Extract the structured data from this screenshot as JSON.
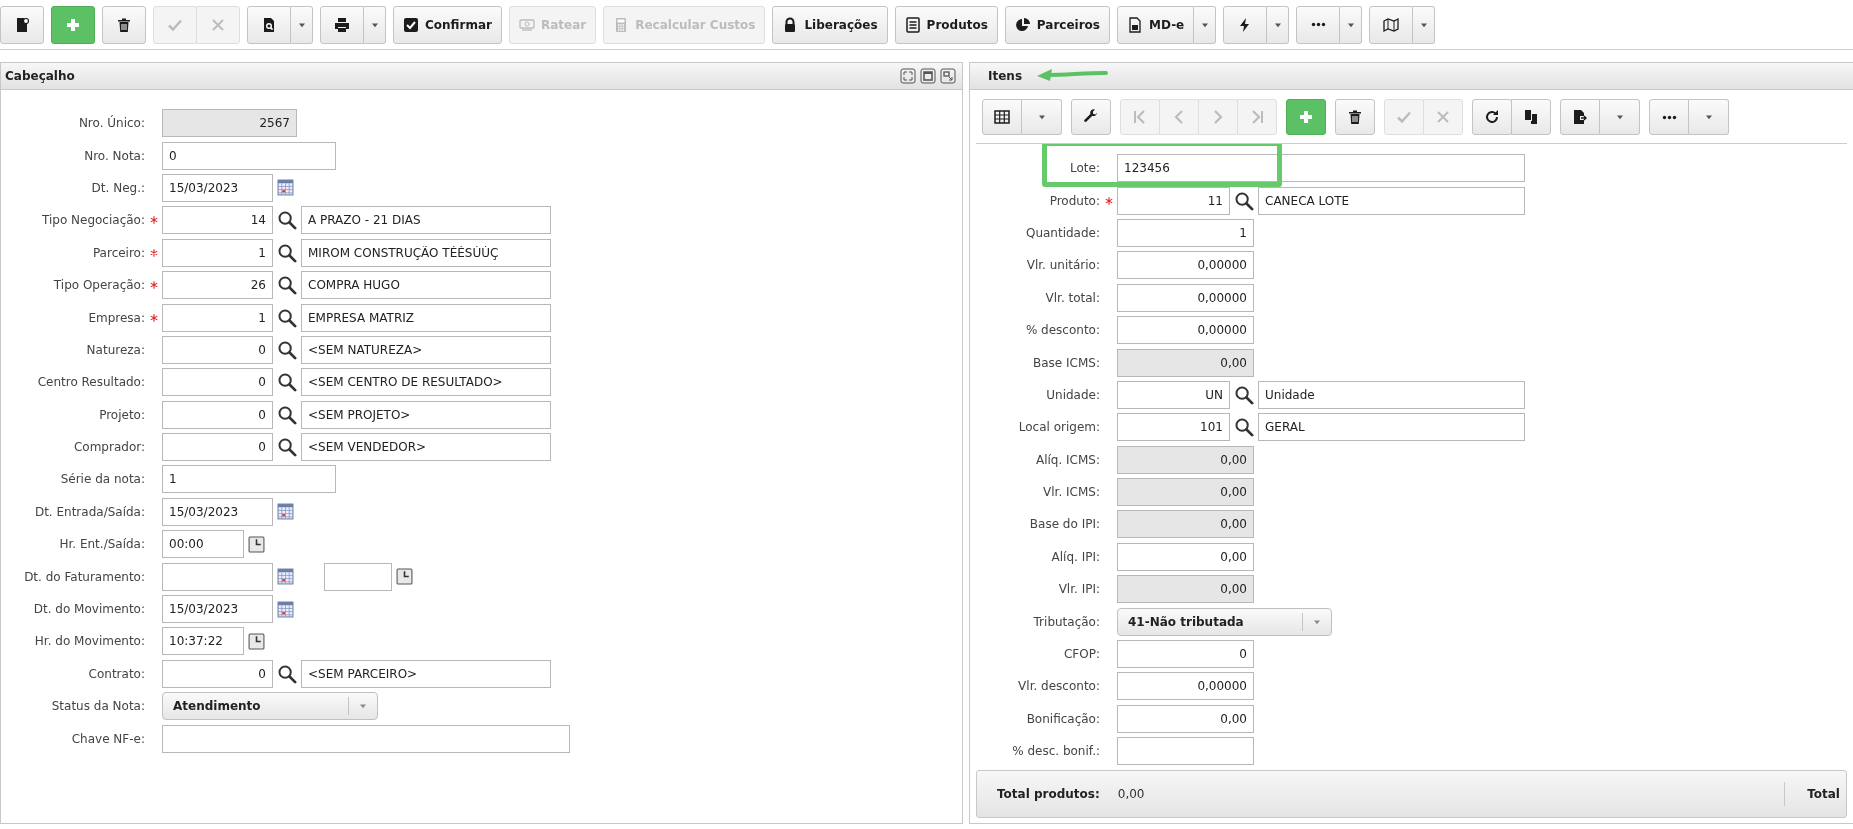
{
  "toolbar": [
    {
      "kind": "icon",
      "disabled": false,
      "dropdown": false
    },
    {
      "kind": "primary",
      "disabled": false,
      "dropdown": false
    },
    {
      "kind": "icon",
      "disabled": false,
      "dropdown": false
    },
    {
      "kind": "icon",
      "disabled": true,
      "dropdown": false
    },
    {
      "kind": "icon",
      "disabled": true,
      "dropdown": false
    },
    {
      "kind": "icon",
      "disabled": false,
      "dropdown": true
    },
    {
      "kind": "icon",
      "disabled": false,
      "dropdown": true
    },
    {
      "kind": "text",
      "label": "Confirmar",
      "disabled": false,
      "dropdown": false
    },
    {
      "kind": "text",
      "label": "Ratear",
      "disabled": true,
      "dropdown": false
    },
    {
      "kind": "text",
      "label": "Recalcular Custos",
      "disabled": true,
      "dropdown": false
    },
    {
      "kind": "text",
      "label": "Liberações",
      "disabled": false,
      "dropdown": false
    },
    {
      "kind": "text",
      "label": "Produtos",
      "disabled": false,
      "dropdown": false
    },
    {
      "kind": "text",
      "label": "Parceiros",
      "disabled": false,
      "dropdown": false
    },
    {
      "kind": "text",
      "label": "MD-e",
      "disabled": false,
      "dropdown": true
    },
    {
      "kind": "icon",
      "disabled": false,
      "dropdown": true
    },
    {
      "kind": "icon",
      "disabled": false,
      "dropdown": true
    },
    {
      "kind": "icon",
      "disabled": false,
      "dropdown": true
    }
  ],
  "header_panel": {
    "title": "Cabeçalho",
    "fields": [
      {
        "label": "Nro. Único:",
        "kind": "number",
        "value": "2567",
        "readonly": true
      },
      {
        "label": "Nro. Nota:",
        "kind": "text",
        "value": "0"
      },
      {
        "label": "Dt. Neg.:",
        "kind": "date",
        "value": "15/03/2023"
      },
      {
        "label": "Tipo Negociação:",
        "kind": "lookup",
        "required": true,
        "code": "14",
        "description": "A PRAZO - 21 DIAS"
      },
      {
        "label": "Parceiro:",
        "kind": "lookup",
        "required": true,
        "code": "1",
        "description": "MIROM CONSTRUÇÃO TÉÉSÚÚÇ"
      },
      {
        "label": "Tipo Operação:",
        "kind": "lookup",
        "required": true,
        "code": "26",
        "description": "COMPRA HUGO"
      },
      {
        "label": "Empresa:",
        "kind": "lookup",
        "required": true,
        "code": "1",
        "description": "EMPRESA MATRIZ"
      },
      {
        "label": "Natureza:",
        "kind": "lookup",
        "required": false,
        "code": "0",
        "description": "<SEM NATUREZA>"
      },
      {
        "label": "Centro Resultado:",
        "kind": "lookup",
        "required": false,
        "code": "0",
        "description": "<SEM CENTRO DE RESULTADO>"
      },
      {
        "label": "Projeto:",
        "kind": "lookup",
        "required": false,
        "code": "0",
        "description": "<SEM PROJETO>"
      },
      {
        "label": "Comprador:",
        "kind": "lookup",
        "required": false,
        "code": "0",
        "description": "<SEM VENDEDOR>"
      },
      {
        "label": "Série da nota:",
        "kind": "text",
        "value": "1"
      },
      {
        "label": "Dt. Entrada/Saída:",
        "kind": "date",
        "value": "15/03/2023"
      },
      {
        "label": "Hr. Ent./Saída:",
        "kind": "time",
        "value": "00:00"
      },
      {
        "label": "Dt. do Faturamento:",
        "kind": "datetime"
      },
      {
        "label": "Dt. do Movimento:",
        "kind": "date",
        "value": "15/03/2023"
      },
      {
        "label": "Hr. do Movimento:",
        "kind": "time",
        "value": "10:37:22"
      },
      {
        "label": "Contrato:",
        "kind": "lookup",
        "required": false,
        "code": "0",
        "description": "<SEM PARCEIRO>"
      },
      {
        "label": "Status da Nota:",
        "kind": "select",
        "value": "Atendimento"
      },
      {
        "label": "Chave NF-e:",
        "kind": "long-text"
      }
    ]
  },
  "items_panel": {
    "title": "Itens",
    "toolbar": [
      {
        "kind": "icon",
        "disabled": false,
        "dropdown": true
      },
      {
        "kind": "icon",
        "disabled": false,
        "dropdown": false
      },
      {
        "kind": "icon",
        "disabled": true,
        "dropdown": false
      },
      {
        "kind": "icon",
        "disabled": true,
        "dropdown": false
      },
      {
        "kind": "icon",
        "disabled": true,
        "dropdown": false
      },
      {
        "kind": "icon",
        "disabled": true,
        "dropdown": false
      },
      {
        "kind": "primary",
        "disabled": false,
        "dropdown": false
      },
      {
        "kind": "icon",
        "disabled": false,
        "dropdown": false
      },
      {
        "kind": "icon",
        "disabled": true,
        "dropdown": false
      },
      {
        "kind": "icon",
        "disabled": true,
        "dropdown": false
      },
      {
        "kind": "icon",
        "disabled": false,
        "dropdown": false
      },
      {
        "kind": "icon",
        "disabled": false,
        "dropdown": false
      },
      {
        "kind": "icon",
        "disabled": false,
        "dropdown": true
      },
      {
        "kind": "icon",
        "disabled": false,
        "dropdown": true
      }
    ],
    "fields": [
      {
        "label": "Lote:",
        "kind": "long-text",
        "value": "123456"
      },
      {
        "label": "Produto:",
        "kind": "lookup",
        "required": true,
        "code": "11",
        "description": "CANECA LOTE"
      },
      {
        "label": "Quantidade:",
        "kind": "number",
        "value": "1",
        "readonly": false
      },
      {
        "label": "Vlr. unitário:",
        "kind": "number",
        "value": "0,00000",
        "readonly": false
      },
      {
        "label": "Vlr. total:",
        "kind": "number",
        "value": "0,00000",
        "readonly": false
      },
      {
        "label": "% desconto:",
        "kind": "number",
        "value": "0,00000",
        "readonly": false
      },
      {
        "label": "Base ICMS:",
        "kind": "number",
        "value": "0,00",
        "readonly": true
      },
      {
        "label": "Unidade:",
        "kind": "lookup",
        "required": false,
        "code": "UN",
        "description": "Unidade"
      },
      {
        "label": "Local origem:",
        "kind": "lookup",
        "required": false,
        "code": "101",
        "description": "GERAL"
      },
      {
        "label": "Alíq. ICMS:",
        "kind": "number",
        "value": "0,00",
        "readonly": true
      },
      {
        "label": "Vlr. ICMS:",
        "kind": "number",
        "value": "0,00",
        "readonly": true
      },
      {
        "label": "Base do IPI:",
        "kind": "number",
        "value": "0,00",
        "readonly": true
      },
      {
        "label": "Alíq. IPI:",
        "kind": "number",
        "value": "0,00",
        "readonly": false
      },
      {
        "label": "Vlr. IPI:",
        "kind": "number",
        "value": "0,00",
        "readonly": true
      },
      {
        "label": "Tributação:",
        "kind": "select",
        "value": "41-Não tributada"
      },
      {
        "label": "CFOP:",
        "kind": "number",
        "value": "0",
        "readonly": false
      },
      {
        "label": "Vlr. desconto:",
        "kind": "number",
        "value": "0,00000",
        "readonly": false
      },
      {
        "label": "Bonificação:",
        "kind": "number",
        "value": "0,00",
        "readonly": false
      },
      {
        "label": "% desc. bonif.:",
        "kind": "number",
        "readonly": false
      }
    ],
    "footer": {
      "label": "Total produtos:",
      "value": "0,00",
      "label_2": "Total"
    }
  }
}
